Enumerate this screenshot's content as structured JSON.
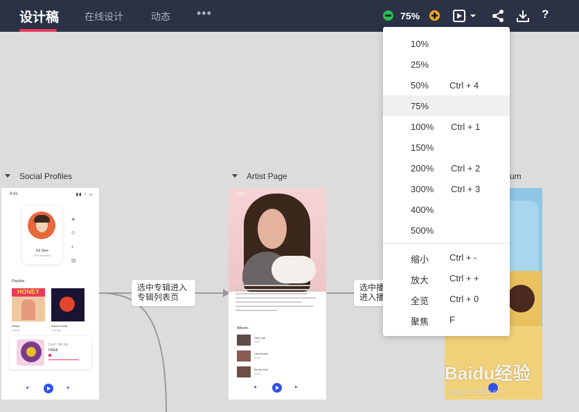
{
  "topbar": {
    "brand": "设计稿",
    "nav": [
      "在线设计",
      "动态"
    ],
    "more": "•••",
    "zoom": "75%",
    "help": "?"
  },
  "zoom_menu": {
    "items": [
      {
        "label": "10%",
        "shortcut": ""
      },
      {
        "label": "25%",
        "shortcut": ""
      },
      {
        "label": "50%",
        "shortcut": "Ctrl + 4"
      },
      {
        "label": "75%",
        "shortcut": "",
        "active": true
      },
      {
        "label": "100%",
        "shortcut": "Ctrl + 1"
      },
      {
        "label": "150%",
        "shortcut": ""
      },
      {
        "label": "200%",
        "shortcut": "Ctrl + 2"
      },
      {
        "label": "300%",
        "shortcut": "Ctrl + 3"
      },
      {
        "label": "400%",
        "shortcut": ""
      },
      {
        "label": "500%",
        "shortcut": ""
      }
    ],
    "actions": [
      {
        "label": "缩小",
        "shortcut": "Ctrl + -"
      },
      {
        "label": "放大",
        "shortcut": "Ctrl + +"
      },
      {
        "label": "全览",
        "shortcut": "Ctrl + 0"
      },
      {
        "label": "聚焦",
        "shortcut": "F"
      }
    ]
  },
  "frames": {
    "social": {
      "title": "Social Profiles",
      "time": "9:41",
      "name": "Ed Stee",
      "followers": "3764 followers",
      "playlists_label": "Playlists",
      "album1_title": "Robyn",
      "album1_sub": "Honey",
      "album2_title": "David Guetta",
      "album2_sub": "7 songs",
      "honey": "HONEY",
      "now_title": "Don't Tell Me",
      "now_artist": "HDE8"
    },
    "artist": {
      "title": "Artist Page",
      "time": "9:41",
      "albums_label": "Albums",
      "albums": [
        {
          "title": "Dua Lipa",
          "sub": "2017"
        },
        {
          "title": "Last Dance",
          "sub": "2016"
        },
        {
          "title": "Be the One",
          "sub": "2015"
        }
      ]
    },
    "album": {
      "title_suffix": "um"
    }
  },
  "tips": {
    "tip1": "选中专辑进入\n专辑列表页",
    "tip2": "选中播\n进入播"
  },
  "watermark": {
    "main": "Baidu经验",
    "sub": "jingyan.baidu.com"
  },
  "colors": {
    "topbar": "#2b3245",
    "accent": "#e8385a",
    "zoom_minus": "#2bbb4e",
    "zoom_plus": "#f5a623",
    "play_blue": "#2f54eb"
  }
}
